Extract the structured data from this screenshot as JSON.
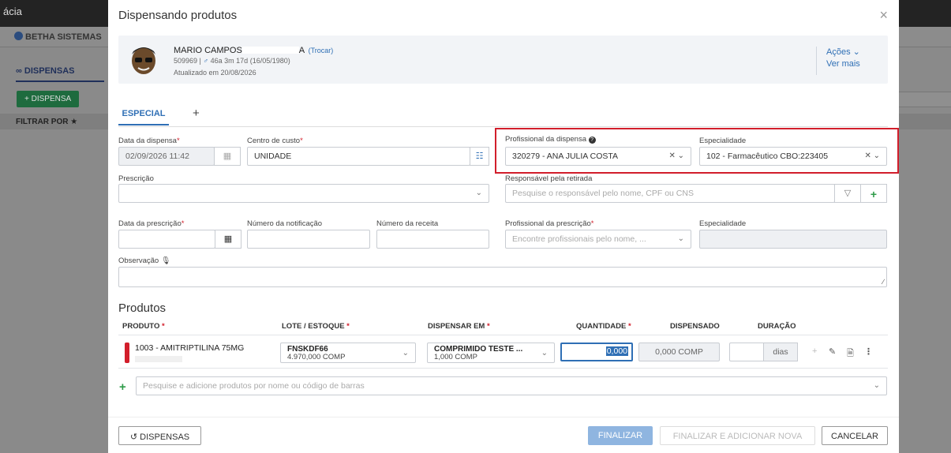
{
  "background": {
    "top_title": "ácia",
    "company": "BETHA SISTEMAS",
    "tab": "DISPENSAS",
    "new_button": "+ DISPENSA",
    "filter_label": "FILTRAR POR"
  },
  "modal": {
    "title": "Dispensando produtos",
    "close": "×",
    "patient": {
      "name": "MARIO CAMPOS",
      "name_suffix": "A",
      "change_link": "(Trocar)",
      "code": "509969",
      "gender_symbol": "♂",
      "age": "46a 3m 17d (16/05/1980)",
      "updated": "Atualizado em 20/08/2026",
      "actions_label": "Ações",
      "see_more_label": "Ver mais"
    },
    "tabs": [
      {
        "label": "ESPECIAL"
      }
    ],
    "add_tab": "+",
    "form": {
      "dispense_date_label": "Data da dispensa",
      "dispense_date_value": "02/09/2026 11:42",
      "cost_center_label": "Centro de custo",
      "cost_center_value": "UNIDADE",
      "professional_label": "Profissional da dispensa",
      "professional_value": "320279 - ANA JULIA COSTA",
      "specialty_label": "Especialidade",
      "specialty_value": "102 - Farmacêutico CBO:223405",
      "prescription_label": "Prescrição",
      "prescription_value": "",
      "pickup_label": "Responsável pela retirada",
      "pickup_placeholder": "Pesquise o responsável pelo nome, CPF ou CNS",
      "prescription_date_label": "Data da prescrição",
      "notification_label": "Número da notificação",
      "recipe_label": "Número da receita",
      "presc_professional_label": "Profissional da prescrição",
      "presc_professional_placeholder": "Encontre profissionais pelo nome, ...",
      "presc_specialty_label": "Especialidade",
      "observation_label": "Observação"
    },
    "products": {
      "title": "Produtos",
      "headers": {
        "product": "PRODUTO",
        "lot": "LOTE / ESTOQUE",
        "dispense_in": "DISPENSAR EM",
        "quantity": "QUANTIDADE",
        "dispensed": "DISPENSADO",
        "duration": "DURAÇÃO"
      },
      "rows": [
        {
          "name": "1003 - AMITRIPTILINA 75MG",
          "lot_code": "FNSKDF66",
          "lot_stock": "4.970,000 COMP",
          "unit_name": "COMPRIMIDO TESTE ...",
          "unit_qty": "1,000 COMP",
          "quantity": "0,000",
          "dispensed": "0,000 COMP",
          "duration_unit": "dias"
        }
      ],
      "search_placeholder": "Pesquise e adicione produtos por nome ou código de barras"
    },
    "footer": {
      "dispenses_button": "DISPENSAS",
      "finish_button": "FINALIZAR",
      "finish_new_button": "FINALIZAR E ADICIONAR NOVA",
      "cancel_button": "CANCELAR"
    }
  },
  "colors": {
    "accent": "#2f6fb5",
    "required": "#d21e2b",
    "highlight_box": "#d21e2b",
    "add_green": "#2e9b48"
  }
}
